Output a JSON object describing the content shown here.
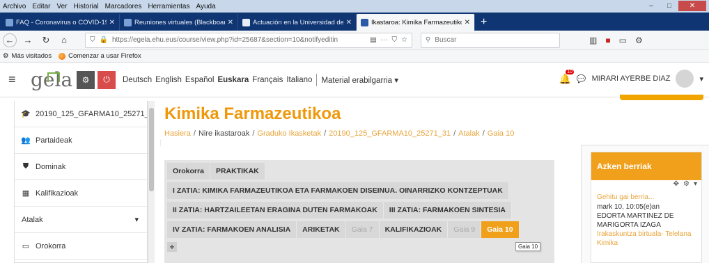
{
  "menubar": [
    "Archivo",
    "Editar",
    "Ver",
    "Historial",
    "Marcadores",
    "Herramientas",
    "Ayuda"
  ],
  "window_controls": [
    "–",
    "□",
    "✕"
  ],
  "tabs": [
    {
      "title": "FAQ - Coronavirus o COVID-19",
      "active": false
    },
    {
      "title": "Reuniones virtuales (Blackboar",
      "active": false
    },
    {
      "title": "Actuación en la Universidad de",
      "active": false
    },
    {
      "title": "Ikastaroa: Kimika Farmazeutikoa",
      "active": true
    }
  ],
  "url": "https://egela.ehu.eus/course/view.php?id=25687&section=10&notifyeditin",
  "search_placeholder": "Buscar",
  "bookmarks": [
    "Más visitados",
    "Comenzar a usar Firefox"
  ],
  "header": {
    "logo_text": "gela",
    "logo_sub": "ela",
    "languages": [
      "Deutsch",
      "English",
      "Español",
      "Euskara",
      "Français",
      "Italiano"
    ],
    "current_language": "Euskara",
    "material_menu": "Material erabilgarria ▾",
    "notif_count": "10",
    "user_name": "MIRARI AYERBE DIAZ"
  },
  "sidebar": {
    "items": [
      {
        "icon": "graduation-cap-icon",
        "glyph": "🎓",
        "label": "20190_125_GFARMA10_25271_"
      },
      {
        "icon": "people-icon",
        "glyph": "👥",
        "label": "Partaideak"
      },
      {
        "icon": "shield-icon",
        "glyph": "⛊",
        "label": "Dominak"
      },
      {
        "icon": "grid-icon",
        "glyph": "▦",
        "label": "Kalifikazioak"
      },
      {
        "icon": "chevron-down-icon",
        "glyph": "▾",
        "label": "Atalak"
      },
      {
        "icon": "folder-icon",
        "glyph": "▭",
        "label": "Orokorra"
      }
    ]
  },
  "main": {
    "title": "Kimika Farmazeutikoa",
    "breadcrumb": [
      "Hasiera",
      "Nire ikastaroak",
      "Graduko Ikasketak",
      "20190_125_GFARMA10_25271_31",
      "Atalak",
      "Gaia 10"
    ],
    "tab_rows": [
      [
        {
          "label": "Orokorra",
          "state": "normal"
        },
        {
          "label": "PRAKTIKAK",
          "state": "normal"
        }
      ],
      [
        {
          "label": "I ZATIA: KIMIKA FARMAZEUTIKOA ETA FARMAKOEN DISEINUA. OINARRIZKO KONTZEPTUAK",
          "state": "normal"
        }
      ],
      [
        {
          "label": "II ZATIA: HARTZAILEETAN ERAGINA DUTEN FARMAKOAK",
          "state": "normal"
        },
        {
          "label": "III ZATIA: FARMAKOEN SINTESIA",
          "state": "normal"
        }
      ],
      [
        {
          "label": "IV ZATIA: FARMAKOEN ANALISIA",
          "state": "normal"
        },
        {
          "label": "ARIKETAK",
          "state": "normal"
        },
        {
          "label": "Gaia 7",
          "state": "dim"
        },
        {
          "label": "KALIFIKAZIOAK",
          "state": "normal"
        },
        {
          "label": "Gaia 9",
          "state": "dim"
        },
        {
          "label": "Gaia 10",
          "state": "active"
        }
      ]
    ],
    "tooltip": "Gaia 10"
  },
  "block": {
    "title": "Azken berriak",
    "add_link": "Gehitu gai berria...",
    "date": "mark 10, 10:05(e)an",
    "author": "EDORTA MARTINEZ DE MARIGORTA IZAGA",
    "post": "Irakaskuntza birtuala- Telelana Kimika"
  },
  "colors": {
    "accent": "#f0a01a",
    "title": "#f0980b",
    "link": "#e8a43a",
    "tabbar": "#0f3572"
  }
}
